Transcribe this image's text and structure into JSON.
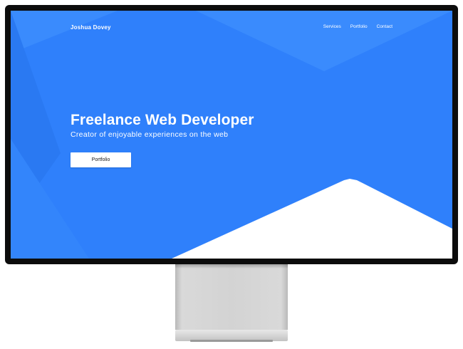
{
  "nav": {
    "brand": "Joshua Dovey",
    "links": [
      "Services",
      "Portfolio",
      "Contact"
    ]
  },
  "hero": {
    "title": "Freelance Web Developer",
    "subtitle": "Creator of enjoyable experiences on the web",
    "button_label": "Portfolio"
  },
  "colors": {
    "primary_blue": "#2f80fb",
    "monitor_bezel": "#0c0c0c",
    "button_bg": "#ffffff"
  }
}
